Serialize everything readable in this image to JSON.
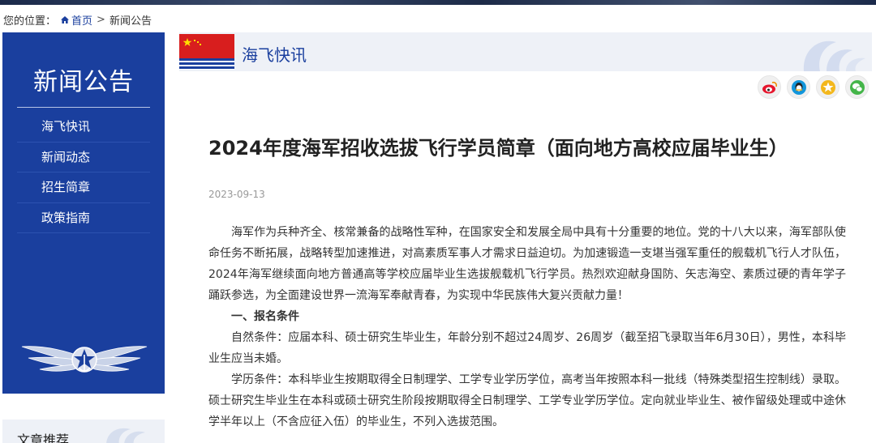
{
  "breadcrumb": {
    "prefix": "您的位置：",
    "home": "首页",
    "separator": ">",
    "current": "新闻公告"
  },
  "sidebar": {
    "title": "新闻公告",
    "items": [
      {
        "label": "海飞快讯"
      },
      {
        "label": "新闻动态"
      },
      {
        "label": "招生简章"
      },
      {
        "label": "政策指南"
      }
    ],
    "recommend_title": "文章推荐"
  },
  "banner": {
    "title": "海飞快讯"
  },
  "share_icons": [
    "weibo-icon",
    "qq-icon",
    "qzone-icon",
    "wechat-icon"
  ],
  "article": {
    "title": "2024年度海军招收选拔飞行学员简章（面向地方高校应届毕业生）",
    "date": "2023-09-13",
    "paragraphs": [
      "海军作为兵种齐全、核常兼备的战略性军种，在国家安全和发展全局中具有十分重要的地位。党的十八大以来，海军部队使命任务不断拓展，战略转型加速推进，对高素质军事人才需求日益迫切。为加速锻造一支堪当强军重任的舰载机飞行人才队伍，2024年海军继续面向地方普通高等学校应届毕业生选拔舰载机飞行学员。热烈欢迎献身国防、矢志海空、素质过硬的青年学子踊跃参选，为全面建设世界一流海军奉献青春，为实现中华民族伟大复兴贡献力量！",
      "一、报名条件",
      "自然条件：应届本科、硕士研究生毕业生，年龄分别不超过24周岁、26周岁（截至招飞录取当年6月30日），男性，本科毕业生应当未婚。",
      "学历条件：本科毕业生按期取得全日制理学、工学专业学历学位，高考当年按照本科一批线（特殊类型招生控制线）录取。硕士研究生毕业生在本科或硕士研究生阶段按期取得全日制理学、工学专业学历学位。定向就业毕业生、被作留级处理或中途休学半年以上（不含应征入伍）的毕业生，不列入选拔范围。"
    ]
  },
  "colors": {
    "navy": "#1a3f9e",
    "flag_red": "#d81e1e",
    "banner_bg": "#eef1f7",
    "weibo": "#e6162d",
    "qq": "#1296db",
    "qzone": "#f3b71c",
    "wechat": "#44b549"
  }
}
